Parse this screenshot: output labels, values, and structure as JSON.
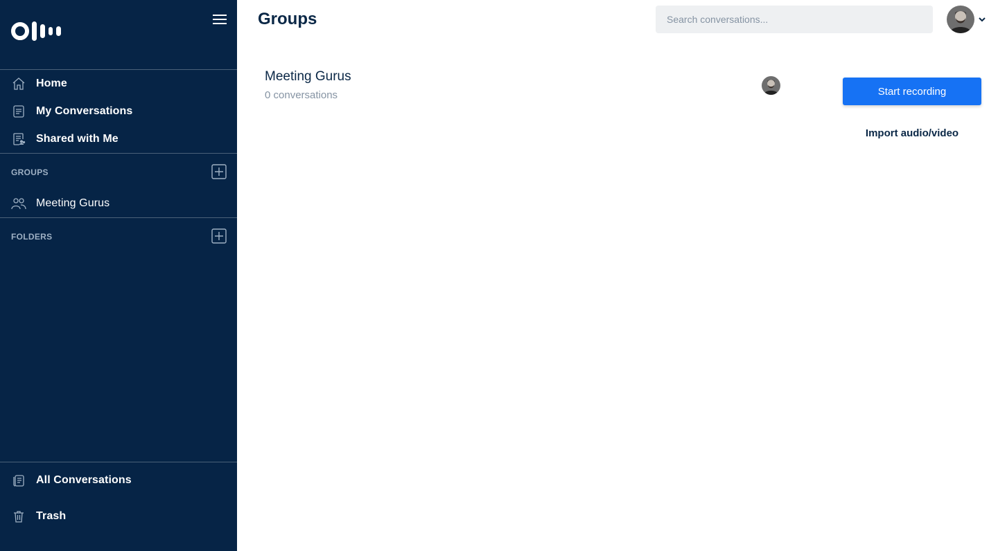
{
  "brand": {
    "sidebar_bg": "#062446",
    "accent": "#1672f4"
  },
  "sidebar": {
    "nav": [
      {
        "label": "Home",
        "icon": "home-icon"
      },
      {
        "label": "My Conversations",
        "icon": "document-icon"
      },
      {
        "label": "Shared with Me",
        "icon": "shared-document-icon"
      }
    ],
    "groups_title": "GROUPS",
    "groups": [
      {
        "label": "Meeting Gurus",
        "icon": "people-icon"
      }
    ],
    "folders_title": "FOLDERS",
    "bottom": [
      {
        "label": "All Conversations",
        "icon": "stacked-documents-icon"
      },
      {
        "label": "Trash",
        "icon": "trash-icon"
      }
    ]
  },
  "header": {
    "title": "Groups",
    "search_placeholder": "Search conversations..."
  },
  "group_card": {
    "name": "Meeting Gurus",
    "count": "0 conversations"
  },
  "actions": {
    "start_recording": "Start recording",
    "import": "Import audio/video"
  }
}
